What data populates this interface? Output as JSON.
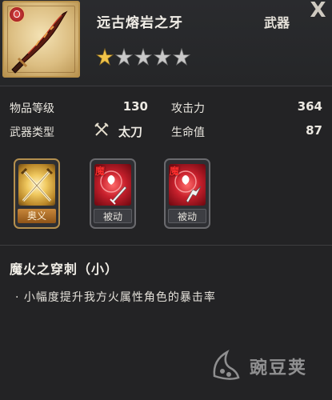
{
  "item": {
    "name": "远古熔岩之牙",
    "type": "武器",
    "stars_filled": 1,
    "stars_total": 5
  },
  "stats": {
    "item_level_label": "物品等级",
    "item_level_value": "130",
    "attack_label": "攻击力",
    "attack_value": "364",
    "weapon_type_label": "武器类型",
    "weapon_type_value": "太刀",
    "hp_label": "生命值",
    "hp_value": "87"
  },
  "skills": [
    {
      "tag": "奥义",
      "corner": ""
    },
    {
      "tag": "被动",
      "corner": "魔"
    },
    {
      "tag": "被动",
      "corner": "魔"
    }
  ],
  "skill_detail": {
    "title": "魔火之穿刺（小）",
    "description": "· 小幅度提升我方火属性角色的暴击率"
  },
  "watermark": {
    "text": "豌豆荚"
  },
  "close": {
    "label": "X"
  },
  "colors": {
    "gold": "#d9b064",
    "star_filled": "#f0c349",
    "star_empty": "#c9c9c9",
    "fire_red": "#c8202c"
  }
}
